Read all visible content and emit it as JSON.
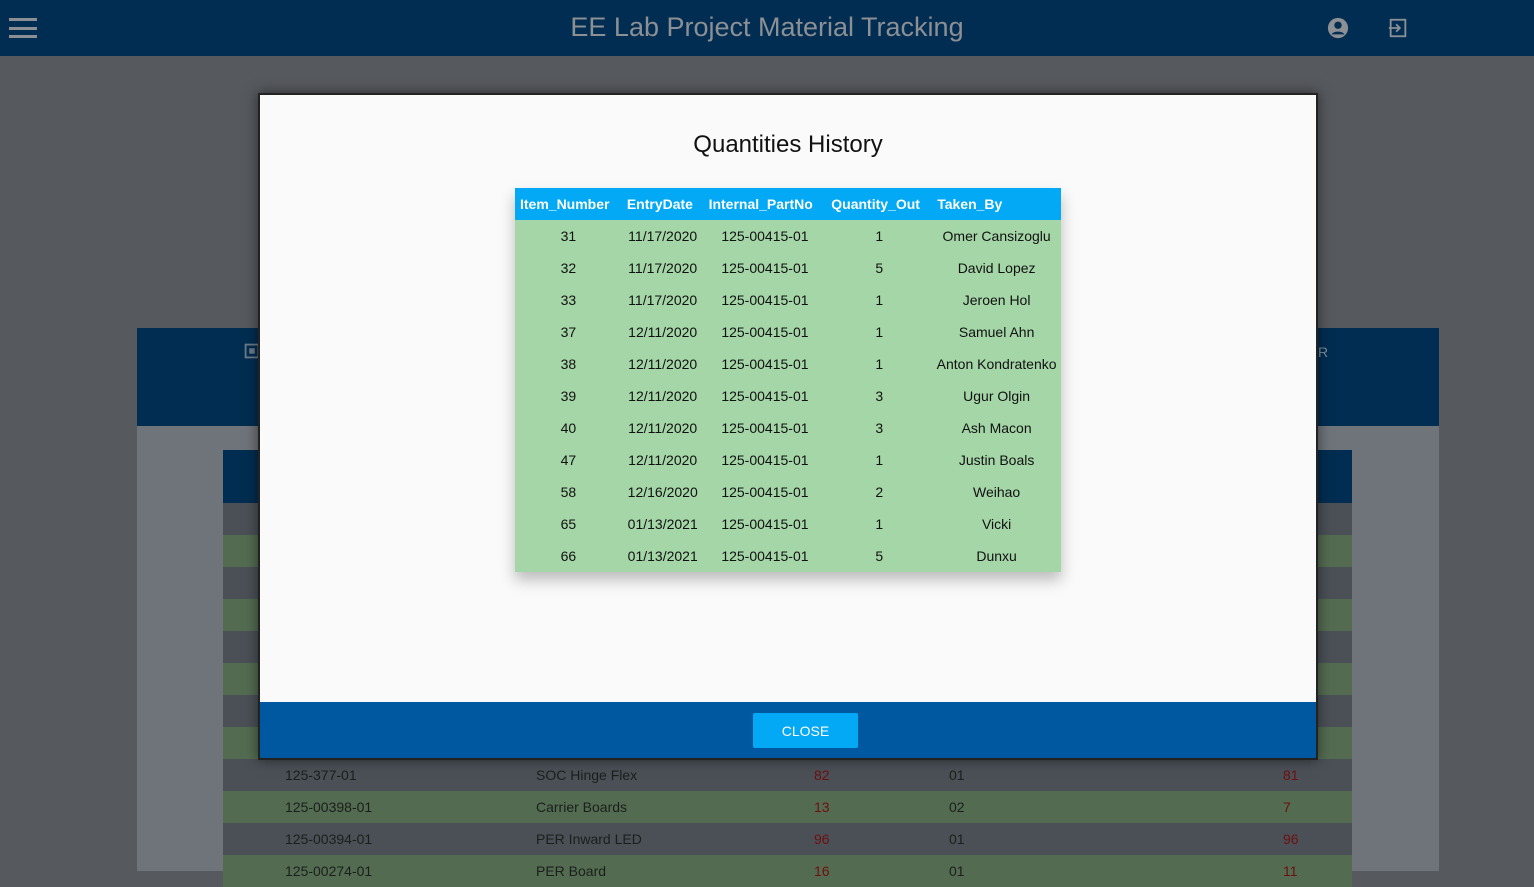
{
  "app": {
    "title": "EE Lab Project Material Tracking"
  },
  "background": {
    "band_fragment": "R",
    "rows": [
      {
        "part": "125-377-01",
        "name": "SOC Hinge Flex",
        "qty": "82",
        "rev": "01",
        "remaining": "81"
      },
      {
        "part": "125-00398-01",
        "name": "Carrier Boards",
        "qty": "13",
        "rev": "02",
        "remaining": "7"
      },
      {
        "part": "125-00394-01",
        "name": "PER Inward LED",
        "qty": "96",
        "rev": "01",
        "remaining": "96"
      },
      {
        "part": "125-00274-01",
        "name": "PER Board",
        "qty": "16",
        "rev": "01",
        "remaining": "11"
      }
    ]
  },
  "modal": {
    "title": "Quantities History",
    "close_label": "CLOSE",
    "columns": [
      "Item_Number",
      "EntryDate",
      "Internal_PartNo",
      "Quantity_Out",
      "Taken_By"
    ],
    "rows": [
      [
        "31",
        "11/17/2020",
        "125-00415-01",
        "1",
        "Omer Cansizoglu"
      ],
      [
        "32",
        "11/17/2020",
        "125-00415-01",
        "5",
        "David Lopez"
      ],
      [
        "33",
        "11/17/2020",
        "125-00415-01",
        "1",
        "Jeroen Hol"
      ],
      [
        "37",
        "12/11/2020",
        "125-00415-01",
        "1",
        "Samuel Ahn"
      ],
      [
        "38",
        "12/11/2020",
        "125-00415-01",
        "1",
        "Anton Kondratenko"
      ],
      [
        "39",
        "12/11/2020",
        "125-00415-01",
        "3",
        "Ugur Olgin"
      ],
      [
        "40",
        "12/11/2020",
        "125-00415-01",
        "3",
        "Ash Macon"
      ],
      [
        "47",
        "12/11/2020",
        "125-00415-01",
        "1",
        "Justin Boals"
      ],
      [
        "58",
        "12/16/2020",
        "125-00415-01",
        "2",
        "Weihao"
      ],
      [
        "65",
        "01/13/2021",
        "125-00415-01",
        "1",
        "Vicki"
      ],
      [
        "66",
        "01/13/2021",
        "125-00415-01",
        "5",
        "Dunxu"
      ]
    ]
  }
}
